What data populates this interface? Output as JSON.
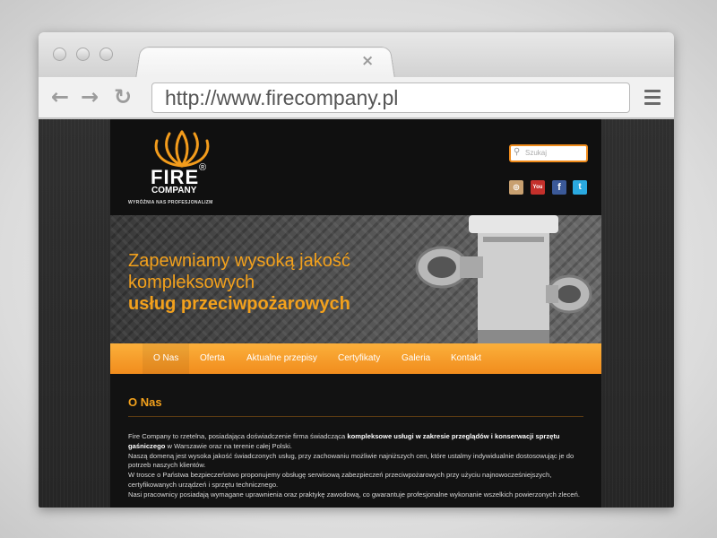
{
  "browser": {
    "url": "http://www.firecompany.pl",
    "tab_close": "×"
  },
  "brand": {
    "name": "FIRE",
    "registered": "®",
    "sub": "COMPANY",
    "tagline": "WYRÓŻNIA NAS PROFESJONALIZM",
    "accent_color": "#f39c1c"
  },
  "search": {
    "placeholder": "Szukaj"
  },
  "social": [
    "rss-icon",
    "youtube-icon",
    "facebook-icon",
    "twitter-icon"
  ],
  "social_labels": {
    "youtube": "You",
    "facebook": "f",
    "twitter": "t",
    "rss": "◎"
  },
  "hero": {
    "line1": "Zapewniamy wysoką jakość",
    "line2": "kompleksowych",
    "line3": "usług przeciwpożarowych"
  },
  "nav": {
    "items": [
      "O Nas",
      "Oferta",
      "Aktualne przepisy",
      "Certyfikaty",
      "Galeria",
      "Kontakt"
    ]
  },
  "content": {
    "title": "O Nas",
    "p1_a": "Fire Company to rzetelna, posiadająca doświadczenie firma świadcząca ",
    "p1_b": "kompleksowe usługi w zakresie przeglądów i konserwacji sprzętu gaśniczego",
    "p1_c": " w Warszawie oraz na terenie całej Polski.",
    "p2": "Naszą domeną jest wysoka jakość świadczonych usług, przy zachowaniu możliwie najniższych cen, które ustalmy indywidualnie dostosowując je do potrzeb naszych klientów.",
    "p3": "W trosce o Państwa bezpieczeństwo proponujemy obsługę serwisową zabezpieczeń przeciwpożarowych przy użyciu najnowocześniejszych, certyfikowanych urządzeń i sprzętu technicznego.",
    "p4": "Nasi pracownicy posiadają wymagane uprawnienia oraz praktykę zawodową, co gwarantuje profesjonalne wykonanie wszelkich powierzonych zleceń."
  }
}
